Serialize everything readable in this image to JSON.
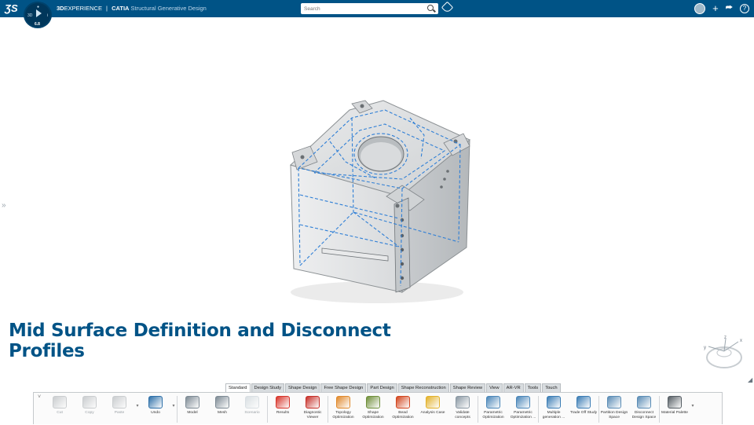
{
  "topbar": {
    "brand_bold": "3D",
    "brand_rest": "EXPERIENCE",
    "separator": "|",
    "app_bold": "CATIA",
    "app_subtitle": "Structural Generative Design",
    "compass_version": "6.8",
    "search_placeholder": "Search",
    "plus_glyph": "+",
    "share_glyph": "⮫",
    "help_glyph": "?"
  },
  "slide": {
    "title": "Mid Surface Definition and Disconnect Profiles"
  },
  "tabs": [
    "Standard",
    "Design Study",
    "Shape Design",
    "Free Shape Design",
    "Part Design",
    "Shape Reconstruction",
    "Shape Review",
    "View",
    "AR-VR",
    "Tools",
    "Touch"
  ],
  "active_tab": "Standard",
  "actionbar": {
    "commands": [
      {
        "label": "Cut",
        "icon": "scissors-icon",
        "disabled": true,
        "color": "#9aa0a5"
      },
      {
        "label": "Copy",
        "icon": "copy-icon",
        "disabled": true,
        "color": "#9aa0a5"
      },
      {
        "label": "Paste",
        "icon": "paste-icon",
        "disabled": true,
        "color": "#9aa0a5"
      },
      {
        "label": "Undo",
        "icon": "undo-icon",
        "disabled": false,
        "color": "#2d6fa8"
      },
      {
        "label": "Model",
        "icon": "model-icon",
        "disabled": false,
        "color": "#7d8a94"
      },
      {
        "label": "Mesh",
        "icon": "mesh-icon",
        "disabled": false,
        "color": "#7d8a94"
      },
      {
        "label": "Scenario",
        "icon": "scenario-icon",
        "disabled": true,
        "color": "#b8c4cc"
      },
      {
        "label": "Results",
        "icon": "results-icon",
        "disabled": false,
        "color": "#d7342a"
      },
      {
        "label": "Diagnostic Viewer",
        "icon": "diagnostic-viewer-icon",
        "disabled": false,
        "color": "#c62f28"
      },
      {
        "label": "Topology Optimization",
        "icon": "topology-optimization-icon",
        "disabled": false,
        "color": "#e0892b"
      },
      {
        "label": "Shape Optimization",
        "icon": "shape-optimization-icon",
        "disabled": false,
        "color": "#6f8f3a"
      },
      {
        "label": "Bead Optimization",
        "icon": "bead-optimization-icon",
        "disabled": false,
        "color": "#d2451e"
      },
      {
        "label": "Analysis Case",
        "icon": "analysis-case-icon",
        "disabled": false,
        "color": "#e2b12a"
      },
      {
        "label": "Validate concepts",
        "icon": "validate-concepts-icon",
        "disabled": false,
        "color": "#8a98a3"
      },
      {
        "label": "Parametric Optimization",
        "icon": "parametric-optimization-icon",
        "disabled": false,
        "color": "#4a86b8"
      },
      {
        "label": "Parametric Optimization ...",
        "icon": "parametric-optimization-2-icon",
        "disabled": false,
        "color": "#4a86b8"
      },
      {
        "label": "Multiple generation ...",
        "icon": "multiple-generation-icon",
        "disabled": false,
        "color": "#3a7cb4"
      },
      {
        "label": "Trade Off Study",
        "icon": "trade-off-study-icon",
        "disabled": false,
        "color": "#3a7cb4"
      },
      {
        "label": "Partition Design Space",
        "icon": "partition-design-space-icon",
        "disabled": false,
        "color": "#5a8cb5"
      },
      {
        "label": "Disconnect Design Space",
        "icon": "disconnect-design-space-icon",
        "disabled": false,
        "color": "#5a8cb5"
      },
      {
        "label": "Material Palette",
        "icon": "material-palette-icon",
        "disabled": false,
        "color": "#555d63"
      }
    ]
  },
  "compass3d": {
    "axis_x": "x",
    "axis_y": "y",
    "axis_z": "z"
  },
  "colors": {
    "topbar": "#005386",
    "title": "#005386",
    "hidden_edges": "#2f7fd6"
  }
}
